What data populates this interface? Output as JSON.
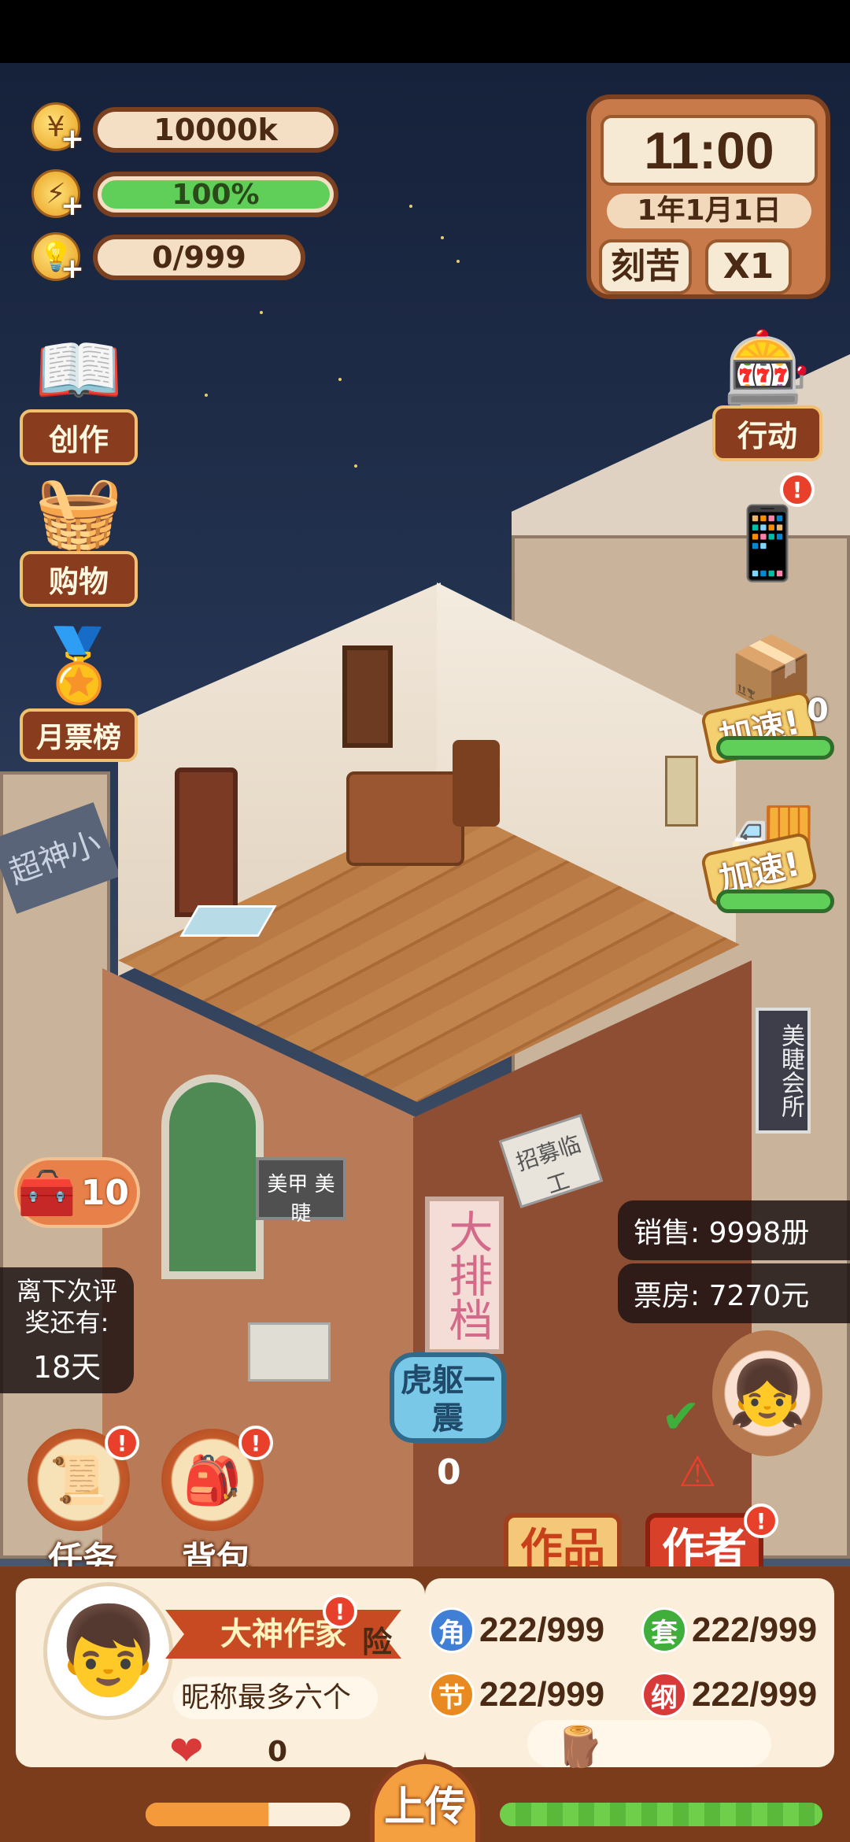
{
  "resources": {
    "coins": "10000k",
    "energy": "100%",
    "energy_level": 1.0,
    "inspiration": "0/999"
  },
  "clock": {
    "time": "11:00",
    "date": "1年1月1日",
    "mode_label": "刻苦",
    "speed_label": "X1"
  },
  "left_menu": {
    "create": "创作",
    "shop": "购物",
    "monthly_rank": "月票榜"
  },
  "right_menu": {
    "action": "行动",
    "accel_1": "加速!",
    "accel_1_count": "0",
    "accel_2": "加速!"
  },
  "chest": {
    "count": "10"
  },
  "award_notice": {
    "text": "离下次评奖还有:",
    "days": "18天"
  },
  "stats": {
    "sales": "销售: 9998册",
    "box_office": "票房: 7270元"
  },
  "tiger_skill": {
    "label": "虎躯一震",
    "count": "0"
  },
  "round_buttons": {
    "tasks": "任务",
    "backpack": "背包"
  },
  "tabs": {
    "works": "作品",
    "author": "作者"
  },
  "profile": {
    "title_badge": "大神作家",
    "genre_partial": "险",
    "nickname": "昵称最多六个",
    "likes": "0"
  },
  "attributes": [
    {
      "icon": "角",
      "value": "222/999",
      "color": "#3f7fd6"
    },
    {
      "icon": "套",
      "value": "222/999",
      "color": "#3fae3a"
    },
    {
      "icon": "节",
      "value": "222/999",
      "color": "#e88a20"
    },
    {
      "icon": "纲",
      "value": "222/999",
      "color": "#d83a3a"
    }
  ],
  "publish": {
    "label": "上传"
  },
  "scene_signs": {
    "recruit": "招募临工",
    "big_sign": "大排档",
    "nail": "美甲 美睫",
    "building_left": "超神小",
    "building_right": "美睫会所"
  }
}
